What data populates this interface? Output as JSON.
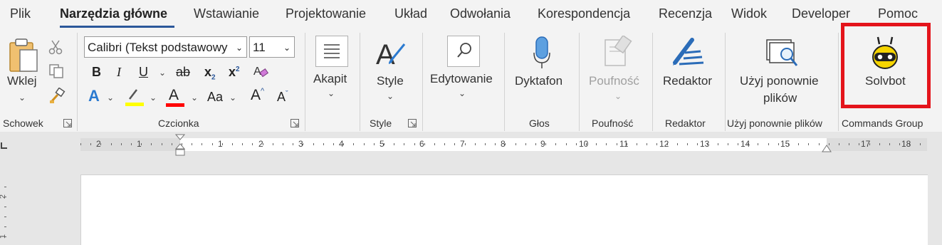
{
  "tabs": [
    {
      "label": "Plik"
    },
    {
      "label": "Narzędzia główne"
    },
    {
      "label": "Wstawianie"
    },
    {
      "label": "Projektowanie"
    },
    {
      "label": "Układ"
    },
    {
      "label": "Odwołania"
    },
    {
      "label": "Korespondencja"
    },
    {
      "label": "Recenzja"
    },
    {
      "label": "Widok"
    },
    {
      "label": "Developer"
    },
    {
      "label": "Pomoc"
    }
  ],
  "clipboard": {
    "paste_label": "Wklej",
    "group_label": "Schowek"
  },
  "font": {
    "name": "Calibri (Tekst podstawowy",
    "size": "11",
    "group_label": "Czcionka",
    "bold": "B",
    "italic": "I",
    "underline": "U",
    "strike": "ab",
    "subscript": "x",
    "superscript": "x",
    "text_effects": "A",
    "font_color": "A",
    "case": "Aa",
    "grow": "A",
    "shrink": "A"
  },
  "paragraph": {
    "label": "Akapit"
  },
  "styles": {
    "label": "Style",
    "group_label": "Style"
  },
  "editing": {
    "label": "Edytowanie"
  },
  "voice": {
    "label": "Dyktafon",
    "group_label": "Głos"
  },
  "sensitivity": {
    "label": "Poufność",
    "group_label": "Poufność"
  },
  "editor": {
    "label": "Redaktor",
    "group_label": "Redaktor"
  },
  "reuse": {
    "label_line1": "Użyj ponownie",
    "label_line2": "plików",
    "group_label": "Użyj ponownie plików"
  },
  "solvbot": {
    "label": "Solvbot",
    "group_label": "Commands Group"
  },
  "ruler": {
    "numbers": [
      "2",
      "1",
      "1",
      "2",
      "3",
      "4",
      "5",
      "6",
      "7",
      "8",
      "9",
      "10",
      "11",
      "12",
      "13",
      "14",
      "15",
      "17",
      "18"
    ]
  },
  "vruler": {
    "numbers": [
      "2",
      "1"
    ]
  },
  "colors": {
    "accent": "#2b579a",
    "highlight_box": "#e4141b",
    "highlight_yellow": "#ffff00",
    "font_red": "#ff0000"
  }
}
